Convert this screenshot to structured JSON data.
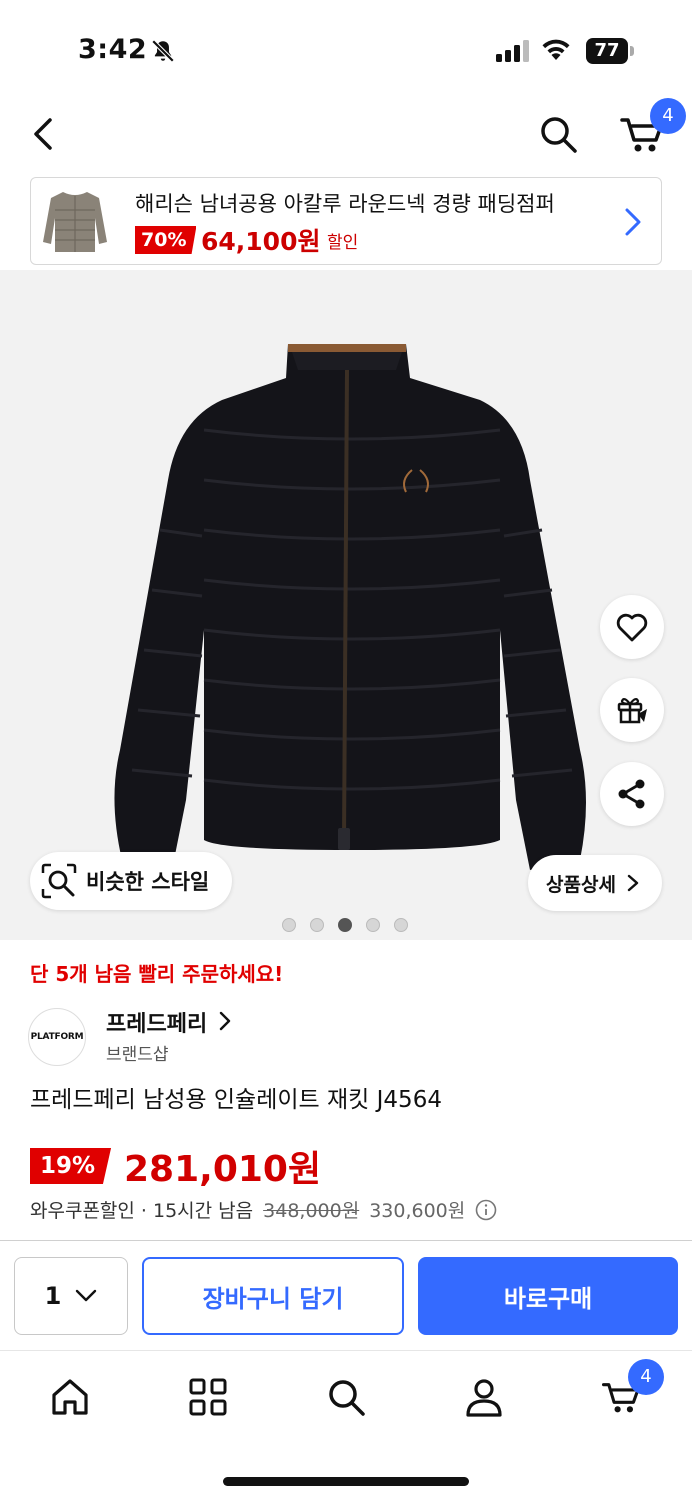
{
  "status_bar": {
    "time": "3:42",
    "battery": "77"
  },
  "header": {
    "cart_count": "4"
  },
  "promo": {
    "title": "해리슨 남녀공용 아칼루 라운드넥 경량 패딩점퍼",
    "discount": "70%",
    "price": "64,100원",
    "sale_label": "할인"
  },
  "hero": {
    "similar_style_label": "비슷한 스타일",
    "detail_label": "상품상세",
    "image_count": 5,
    "active_image_index": 3
  },
  "product": {
    "stock_notice": "단 5개 남음 빨리 주문하세요!",
    "brand_logo_text": "PLATFORM",
    "brand_name": "프레드페리",
    "brand_type": "브랜드샵",
    "name": "프레드페리 남성용 인슐레이트 재킷 J4564",
    "discount": "19%",
    "price": "281,010원",
    "coupon_label": "와우쿠폰할인 · 15시간 남음",
    "original_price": "348,000원",
    "coupon_price": "330,600원"
  },
  "purchase_bar": {
    "quantity": "1",
    "add_to_cart": "장바구니 담기",
    "buy_now": "바로구매"
  },
  "tab_bar": {
    "cart_count": "4"
  },
  "colors": {
    "accent": "#346aff",
    "sale_red": "#e00000",
    "price_red": "#d10000"
  }
}
